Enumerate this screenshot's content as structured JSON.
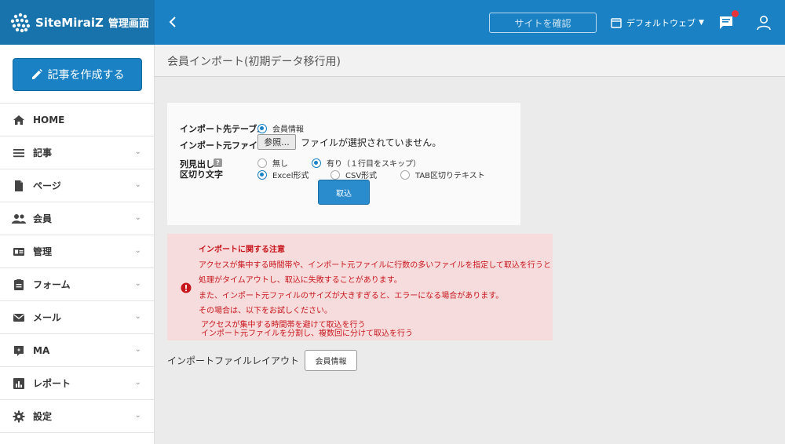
{
  "header": {
    "brand_name": "SiteMiraiZ",
    "brand_sub": "管理画面",
    "site_check_label": "サイトを確認",
    "web_select_label": "デフォルトウェブ",
    "colors": {
      "header": "#1a82c4",
      "brand": "#1873ad",
      "notification": "#e8323a"
    }
  },
  "sidebar": {
    "create_label": "記事を作成する",
    "items": [
      {
        "label": "HOME",
        "icon": "home-icon"
      },
      {
        "label": "記事",
        "icon": "list-icon"
      },
      {
        "label": "ページ",
        "icon": "page-icon"
      },
      {
        "label": "会員",
        "icon": "members-icon"
      },
      {
        "label": "管理",
        "icon": "admin-icon"
      },
      {
        "label": "フォーム",
        "icon": "form-icon"
      },
      {
        "label": "メール",
        "icon": "mail-icon"
      },
      {
        "label": "MA",
        "icon": "ma-icon"
      },
      {
        "label": "レポート",
        "icon": "report-icon"
      },
      {
        "label": "設定",
        "icon": "settings-icon"
      }
    ]
  },
  "page": {
    "title": "会員インポート(初期データ移行用)"
  },
  "form": {
    "target_table_label": "インポート先テーブル",
    "target_table_option": "会員情報",
    "source_file_label": "インポート元ファイル",
    "browse_label": "参照...",
    "no_file_text": "ファイルが選択されていません。",
    "header_row_label": "列見出し",
    "help_badge": "?",
    "header_none": "無し",
    "header_yes": "有り（１行目をスキップ）",
    "delimiter_label": "区切り文字",
    "delim_excel": "Excel形式",
    "delim_csv": "CSV形式",
    "delim_tab": "TAB区切りテキスト",
    "import_button": "取込"
  },
  "notice": {
    "title": "インポートに関する注意",
    "line1": "アクセスが集中する時間帯や、インポート元ファイルに行数の多いファイルを指定して取込を行うと",
    "line2": "処理がタイムアウトし、取込に失敗することがあります。",
    "line3": "また、インポート元ファイルのサイズが大きすぎると、エラーになる場合があります。",
    "line4": "その場合は、以下をお試しください。",
    "tip1": "アクセスが集中する時間帯を避けて取込を行う",
    "tip2": "インポート元ファイルを分割し、複数回に分けて取込を行う"
  },
  "layout": {
    "label": "インポートファイルレイアウト",
    "member_button": "会員情報"
  }
}
